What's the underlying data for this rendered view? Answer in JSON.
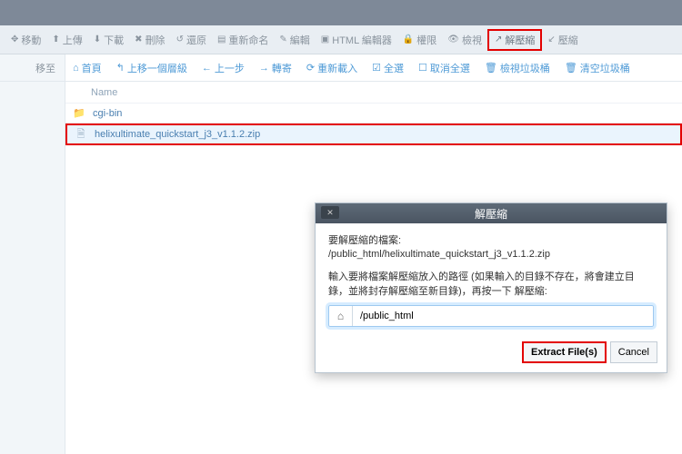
{
  "toolbar": {
    "move": "移動",
    "upload": "上傳",
    "download": "下載",
    "delete": "刪除",
    "restore": "還原",
    "rename": "重新命名",
    "edit": "編輯",
    "html_editor": "HTML 編輯器",
    "permissions": "權限",
    "view": "檢視",
    "extract": "解壓縮",
    "compress": "壓縮"
  },
  "secondbar": {
    "moveto": "移至",
    "home": "首頁",
    "uplevel": "上移一個層級",
    "back": "上一步",
    "forward": "轉寄",
    "reload": "重新載入",
    "select_all": "全選",
    "deselect_all": "取消全選",
    "view_trash": "檢視垃圾桶",
    "empty_trash": "清空垃圾桶"
  },
  "files": {
    "header_name": "Name",
    "rows": [
      {
        "type": "folder",
        "name": "cgi-bin"
      },
      {
        "type": "file",
        "name": "helixultimate_quickstart_j3_v1.1.2.zip",
        "selected": true
      }
    ]
  },
  "modal": {
    "title": "解壓縮",
    "line1": "要解壓縮的檔案:",
    "line2": "/public_html/helixultimate_quickstart_j3_v1.1.2.zip",
    "line3": "輸入要將檔案解壓縮放入的路徑 (如果輸入的目錄不存在，將會建立目錄，並將封存解壓縮至新目錄)，再按一下 解壓縮:",
    "input_value": "/public_html",
    "btn_extract": "Extract File(s)",
    "btn_cancel": "Cancel"
  }
}
